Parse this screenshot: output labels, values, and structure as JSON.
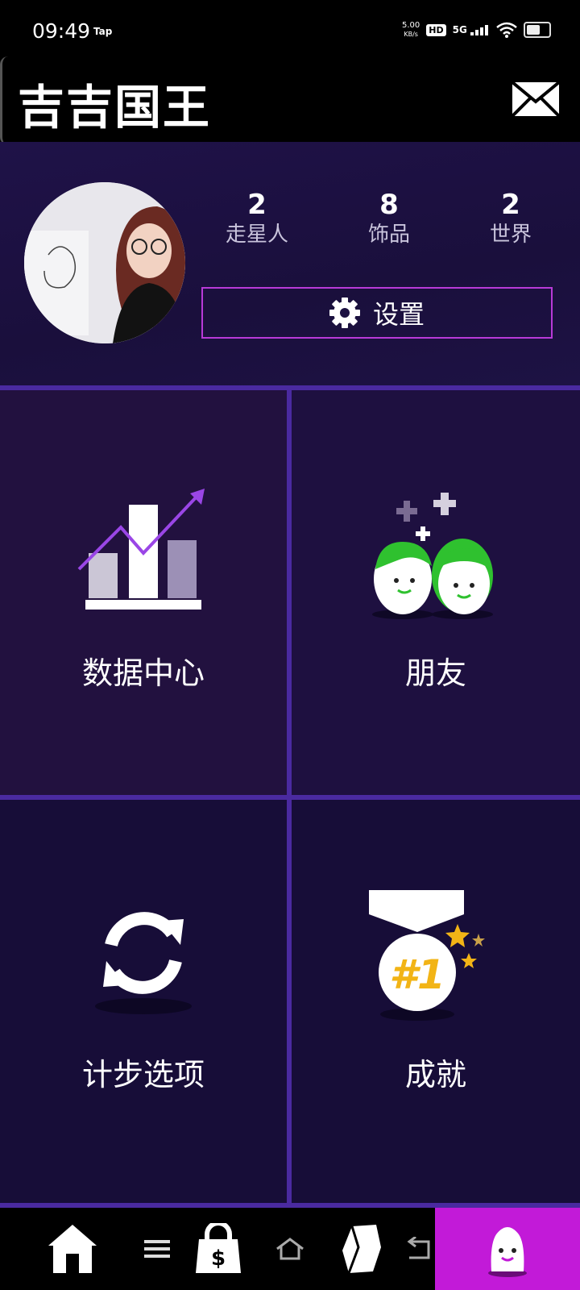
{
  "status_bar": {
    "time": "09:49",
    "tap_label": "Tap",
    "net_speed": "5.00",
    "net_unit": "KB/s",
    "hd": "HD",
    "network": "5G"
  },
  "header": {
    "title": "吉吉国王"
  },
  "profile": {
    "stats": [
      {
        "value": "2",
        "label": "走星人"
      },
      {
        "value": "8",
        "label": "饰品"
      },
      {
        "value": "2",
        "label": "世界"
      }
    ],
    "settings_label": "设置"
  },
  "tiles": [
    {
      "label": "数据中心",
      "icon": "chart-icon"
    },
    {
      "label": "朋友",
      "icon": "friends-icon"
    },
    {
      "label": "计步选项",
      "icon": "sync-icon"
    },
    {
      "label": "成就",
      "icon": "medal-icon"
    }
  ],
  "medal_text": "#1",
  "bottom_nav": {
    "items": [
      "home-icon",
      "shop-icon",
      "gem-icon",
      "profile-icon"
    ],
    "active": "profile-icon",
    "active_color": "#c21ad8"
  },
  "colors": {
    "accent_purple": "#b83ad8",
    "grid_line": "#4a2aa0",
    "panel_bg": "#170d38"
  }
}
